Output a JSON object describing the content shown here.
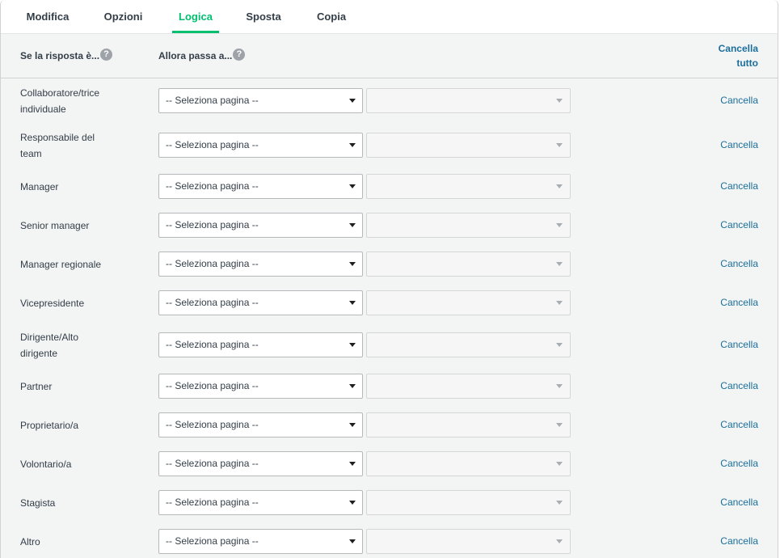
{
  "tabs": [
    {
      "label": "Modifica"
    },
    {
      "label": "Opzioni"
    },
    {
      "label": "Logica"
    },
    {
      "label": "Sposta"
    },
    {
      "label": "Copia"
    }
  ],
  "header": {
    "answer_col": "Se la risposta è...",
    "goto_col": "Allora passa a...",
    "help_symbol": "?",
    "clear_all_line1": "Cancella",
    "clear_all_line2": "tutto"
  },
  "select_placeholder": "-- Seleziona pagina --",
  "clear_label": "Cancella",
  "rows": [
    {
      "line1": "Collaboratore/trice",
      "line2": "individuale"
    },
    {
      "line1": "Responsabile del",
      "line2": "team"
    },
    {
      "line1": "Manager",
      "line2": ""
    },
    {
      "line1": "Senior manager",
      "line2": ""
    },
    {
      "line1": "Manager regionale",
      "line2": ""
    },
    {
      "line1": "Vicepresidente",
      "line2": ""
    },
    {
      "line1": "Dirigente/Alto",
      "line2": "dirigente"
    },
    {
      "line1": "Partner",
      "line2": ""
    },
    {
      "line1": "Proprietario/a",
      "line2": ""
    },
    {
      "line1": "Volontario/a",
      "line2": ""
    },
    {
      "line1": "Stagista",
      "line2": ""
    },
    {
      "line1": "Altro",
      "line2": ""
    }
  ],
  "colors": {
    "accent": "#00bf6f",
    "link": "#1b6f9c"
  }
}
